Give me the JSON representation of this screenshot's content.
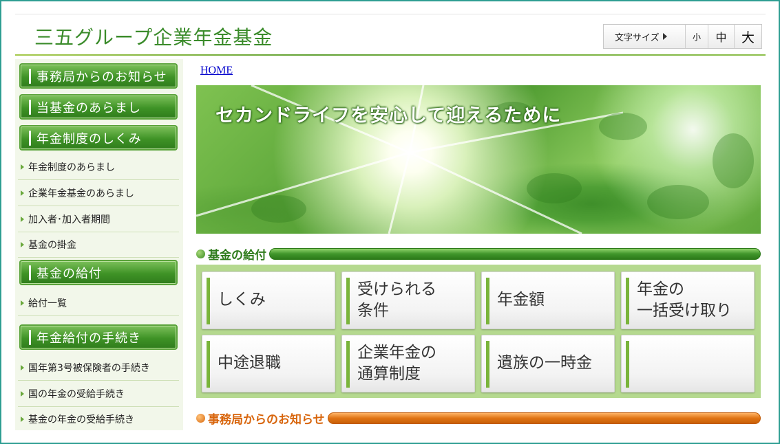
{
  "site": {
    "title": "三五グループ企業年金基金"
  },
  "font_size": {
    "label": "文字サイズ",
    "small": "小",
    "medium": "中",
    "large": "大"
  },
  "breadcrumb": {
    "home": "HOME"
  },
  "hero": {
    "text": "セカンドライフを安心して迎えるために"
  },
  "sidebar": {
    "items": [
      {
        "type": "head",
        "label": "事務局からのお知らせ"
      },
      {
        "type": "head",
        "label": "当基金のあらまし"
      },
      {
        "type": "head",
        "label": "年金制度のしくみ"
      },
      {
        "type": "link",
        "label": "年金制度のあらまし"
      },
      {
        "type": "link",
        "label": "企業年金基金のあらまし"
      },
      {
        "type": "link",
        "label": "加入者･加入者期間"
      },
      {
        "type": "link",
        "label": "基金の掛金"
      },
      {
        "type": "head",
        "label": "基金の給付"
      },
      {
        "type": "link",
        "label": "給付一覧"
      },
      {
        "type": "head",
        "label": "年金給付の手続き"
      },
      {
        "type": "link",
        "label": "国年第3号被保険者の手続き"
      },
      {
        "type": "link",
        "label": "国の年金の受給手続き"
      },
      {
        "type": "link",
        "label": "基金の年金の受給手続き"
      }
    ]
  },
  "benefit_section": {
    "title": "基金の給付",
    "buttons": [
      {
        "label": "しくみ"
      },
      {
        "label": "受けられる\n条件"
      },
      {
        "label": "年金額"
      },
      {
        "label": "年金の\n一括受け取り"
      },
      {
        "label": "中途退職"
      },
      {
        "label": "企業年金の\n通算制度"
      },
      {
        "label": "遺族の一時金"
      },
      {
        "label": ""
      }
    ]
  },
  "news_section": {
    "title": "事務局からのお知らせ"
  },
  "colors": {
    "brand_green": "#3a8b2a",
    "accent_orange": "#d8650c",
    "frame_teal": "#2e9e92"
  }
}
